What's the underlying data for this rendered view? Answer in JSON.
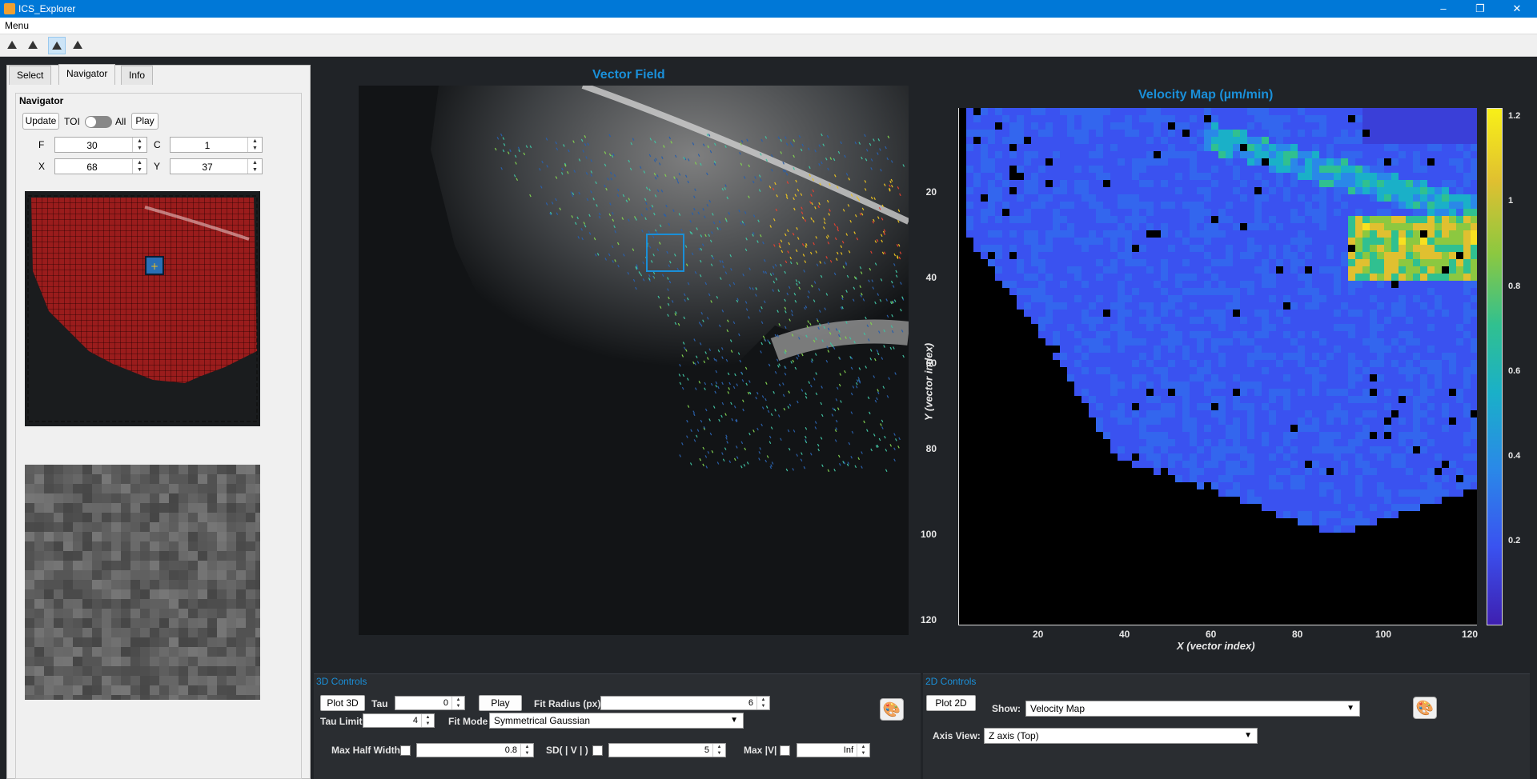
{
  "window": {
    "title": "ICS_Explorer",
    "minimize": "–",
    "maximize": "❐",
    "close": "✕"
  },
  "menubar": {
    "menu": "Menu"
  },
  "toolbar": {
    "icons": [
      "plot-icon",
      "plot-icon",
      "image-plot-icon",
      "plot-icon"
    ],
    "glyph": "⛰"
  },
  "left": {
    "tabs": [
      "Select",
      "Navigator",
      "Info"
    ],
    "selected_tab": "Navigator",
    "navigator": {
      "legend": "Navigator",
      "update_label": "Update",
      "toi_label": "TOI",
      "all_label": "All",
      "play_label": "Play",
      "f_label": "F",
      "f_value": "30",
      "c_label": "C",
      "c_value": "1",
      "x_label": "X",
      "x_value": "68",
      "y_label": "Y",
      "y_value": "37"
    }
  },
  "vector_field": {
    "title": "Vector Field"
  },
  "velocity_map": {
    "title": "Velocity  Map  (µm/min)",
    "xlabel": "X (vector index)",
    "ylabel": "Y (vector index)",
    "xticks": [
      "20",
      "40",
      "60",
      "80",
      "100",
      "120"
    ],
    "yticks": [
      "20",
      "40",
      "60",
      "80",
      "100",
      "120"
    ],
    "colorbar_ticks": [
      "1.2",
      "1",
      "0.8",
      "0.6",
      "0.4",
      "0.2"
    ]
  },
  "controls3d": {
    "title": "3D Controls",
    "plot_label": "Plot 3D",
    "tau_label": "Tau",
    "tau_value": "0",
    "play_label": "Play",
    "fit_radius_label": "Fit Radius (px)",
    "fit_radius_value": "6",
    "tau_limit_label": "Tau Limit",
    "tau_limit_value": "4",
    "fit_mode_label": "Fit Mode",
    "fit_mode_value": "Symmetrical Gaussian",
    "max_half_width_label": "Max Half Width",
    "max_half_width_value": "0.8",
    "sd_label": "SD( | V | )",
    "sd_value": "5",
    "maxv_label": "Max |V|",
    "maxv_value": "Inf"
  },
  "controls2d": {
    "title": "2D Controls",
    "plot_label": "Plot 2D",
    "show_label": "Show:",
    "show_value": "Velocity Map",
    "axis_view_label": "Axis View:",
    "axis_view_value": "Z axis (Top)"
  },
  "colors": {
    "accent": "#1a8fd8",
    "background": "#202327",
    "titlebar": "#0078d7"
  }
}
